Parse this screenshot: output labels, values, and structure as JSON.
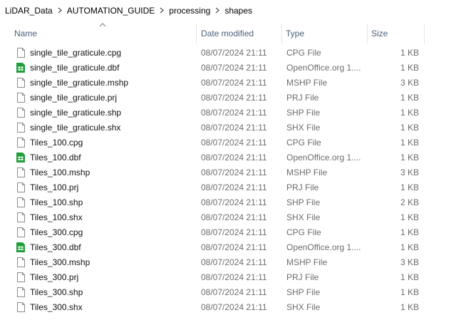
{
  "breadcrumb": {
    "items": [
      "LiDAR_Data",
      "AUTOMATION_GUIDE",
      "processing",
      "shapes"
    ]
  },
  "columns": {
    "name": "Name",
    "date_modified": "Date modified",
    "type": "Type",
    "size": "Size"
  },
  "files": [
    {
      "name": "single_tile_graticule.cpg",
      "date": "08/07/2024 21:11",
      "type": "CPG File",
      "size": "1 KB",
      "icon": "file-icon"
    },
    {
      "name": "single_tile_graticule.dbf",
      "date": "08/07/2024 21:11",
      "type": "OpenOffice.org 1....",
      "size": "1 KB",
      "icon": "spreadsheet-icon"
    },
    {
      "name": "single_tile_graticule.mshp",
      "date": "08/07/2024 21:11",
      "type": "MSHP File",
      "size": "3 KB",
      "icon": "file-icon"
    },
    {
      "name": "single_tile_graticule.prj",
      "date": "08/07/2024 21:11",
      "type": "PRJ File",
      "size": "1 KB",
      "icon": "file-icon"
    },
    {
      "name": "single_tile_graticule.shp",
      "date": "08/07/2024 21:11",
      "type": "SHP File",
      "size": "1 KB",
      "icon": "file-icon"
    },
    {
      "name": "single_tile_graticule.shx",
      "date": "08/07/2024 21:11",
      "type": "SHX File",
      "size": "1 KB",
      "icon": "file-icon"
    },
    {
      "name": "Tiles_100.cpg",
      "date": "08/07/2024 21:11",
      "type": "CPG File",
      "size": "1 KB",
      "icon": "file-icon"
    },
    {
      "name": "Tiles_100.dbf",
      "date": "08/07/2024 21:11",
      "type": "OpenOffice.org 1....",
      "size": "1 KB",
      "icon": "spreadsheet-icon"
    },
    {
      "name": "Tiles_100.mshp",
      "date": "08/07/2024 21:11",
      "type": "MSHP File",
      "size": "3 KB",
      "icon": "file-icon"
    },
    {
      "name": "Tiles_100.prj",
      "date": "08/07/2024 21:11",
      "type": "PRJ File",
      "size": "1 KB",
      "icon": "file-icon"
    },
    {
      "name": "Tiles_100.shp",
      "date": "08/07/2024 21:11",
      "type": "SHP File",
      "size": "2 KB",
      "icon": "file-icon"
    },
    {
      "name": "Tiles_100.shx",
      "date": "08/07/2024 21:11",
      "type": "SHX File",
      "size": "1 KB",
      "icon": "file-icon"
    },
    {
      "name": "Tiles_300.cpg",
      "date": "08/07/2024 21:11",
      "type": "CPG File",
      "size": "1 KB",
      "icon": "file-icon"
    },
    {
      "name": "Tiles_300.dbf",
      "date": "08/07/2024 21:11",
      "type": "OpenOffice.org 1....",
      "size": "1 KB",
      "icon": "spreadsheet-icon"
    },
    {
      "name": "Tiles_300.mshp",
      "date": "08/07/2024 21:11",
      "type": "MSHP File",
      "size": "3 KB",
      "icon": "file-icon"
    },
    {
      "name": "Tiles_300.prj",
      "date": "08/07/2024 21:11",
      "type": "PRJ File",
      "size": "1 KB",
      "icon": "file-icon"
    },
    {
      "name": "Tiles_300.shp",
      "date": "08/07/2024 21:11",
      "type": "SHP File",
      "size": "1 KB",
      "icon": "file-icon"
    },
    {
      "name": "Tiles_300.shx",
      "date": "08/07/2024 21:11",
      "type": "SHX File",
      "size": "1 KB",
      "icon": "file-icon"
    }
  ],
  "colors": {
    "header_text": "#4c607a",
    "secondary_text": "#6d6d6d",
    "spreadsheet_green": "#1e9e3a"
  }
}
